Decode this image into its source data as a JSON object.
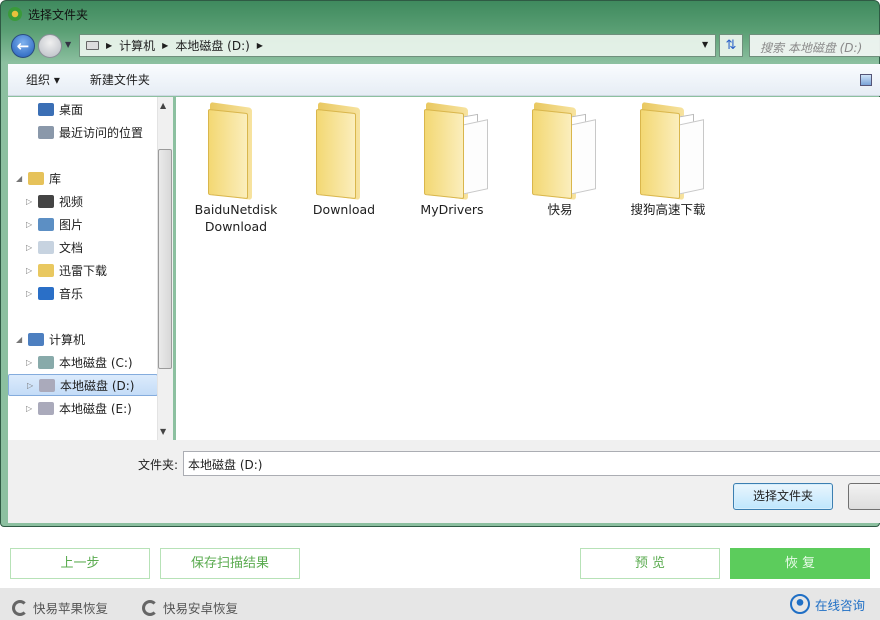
{
  "dialog": {
    "title": "选择文件夹",
    "breadcrumb": [
      "计算机",
      "本地磁盘 (D:)"
    ],
    "search_placeholder": "搜索 本地磁盘 (D:)",
    "toolbar": {
      "organize": "组织 ▾",
      "new_folder": "新建文件夹"
    },
    "nav": [
      {
        "label": "桌面",
        "icon": "desktop-icon"
      },
      {
        "label": "最近访问的位置",
        "icon": "recent-places-icon"
      },
      {
        "label": "库",
        "icon": "library-icon",
        "expanded": true
      },
      {
        "label": "视频",
        "icon": "video-icon"
      },
      {
        "label": "图片",
        "icon": "pictures-icon"
      },
      {
        "label": "文档",
        "icon": "documents-icon"
      },
      {
        "label": "迅雷下载",
        "icon": "folder-icon"
      },
      {
        "label": "音乐",
        "icon": "music-icon"
      },
      {
        "label": "计算机",
        "icon": "computer-icon",
        "expanded": true
      },
      {
        "label": "本地磁盘 (C:)",
        "icon": "system-drive-icon"
      },
      {
        "label": "本地磁盘 (D:)",
        "icon": "drive-icon",
        "selected": true
      },
      {
        "label": "本地磁盘 (E:)",
        "icon": "drive-icon"
      }
    ],
    "folders": [
      "BaiduNetdiskDownload",
      "Download",
      "MyDrivers",
      "快易",
      "搜狗高速下载"
    ],
    "folder_label": "文件夹:",
    "folder_value": "本地磁盘 (D:)",
    "select_button": "选择文件夹"
  },
  "app": {
    "prev": "上一步",
    "save_scan": "保存扫描结果",
    "preview": "预 览",
    "restore": "恢 复",
    "footer": {
      "apple": "快易苹果恢复",
      "android": "快易安卓恢复",
      "consult": "在线咨询"
    },
    "accent": "#5ccc5c"
  }
}
